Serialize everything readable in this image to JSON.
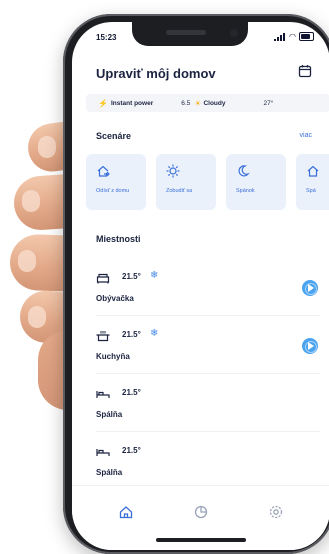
{
  "status_bar": {
    "time": "15:23"
  },
  "header": {
    "title": "Upraviť môj domov",
    "calendar_icon": "calendar-icon"
  },
  "info_bar": {
    "power_label": "Instant power",
    "power_value": "6.5",
    "weather": "Cloudy",
    "temperature": "27°"
  },
  "scenarios": {
    "title": "Scenáre",
    "more_label": "viac",
    "items": [
      {
        "label": "Odísť z domu",
        "icon": "leave-home-icon"
      },
      {
        "label": "Zobudiť sa",
        "icon": "sun-icon"
      },
      {
        "label": "Spánok",
        "icon": "moon-icon"
      },
      {
        "label": "Spá",
        "icon": "home-icon"
      }
    ]
  },
  "rooms": {
    "title": "Miestnosti",
    "items": [
      {
        "name": "Obývačka",
        "temperature": "21.5°",
        "cooling": true,
        "icon": "sofa-icon"
      },
      {
        "name": "Kuchyňa",
        "temperature": "21.5°",
        "cooling": true,
        "icon": "pot-icon"
      },
      {
        "name": "Spálňa",
        "temperature": "21.5°",
        "cooling": false,
        "icon": "bed-icon"
      },
      {
        "name": "Spálňa",
        "temperature": "21.5°",
        "cooling": false,
        "icon": "bed-icon"
      }
    ]
  },
  "tabbar": {
    "tabs": [
      "home-icon",
      "chart-icon",
      "settings-icon"
    ]
  },
  "colors": {
    "accent": "#3a6fd8",
    "card_bg": "#eaf1fb",
    "play": "#4aa3ef",
    "text": "#1b2340"
  }
}
